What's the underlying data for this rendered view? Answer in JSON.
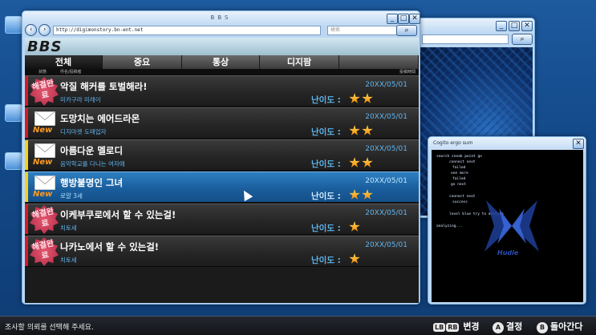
{
  "main_window": {
    "title": "BBS",
    "url": "http://digimonstory.bn-ent.net",
    "search_placeholder": "検索",
    "logo": "BBS"
  },
  "tabs": [
    {
      "label": "전체",
      "active": true
    },
    {
      "label": "중요",
      "active": false
    },
    {
      "label": "통상",
      "active": false
    },
    {
      "label": "디지팜",
      "active": false
    }
  ],
  "columns": {
    "status": "状態",
    "title": "件名/投稿者",
    "date": "投稿時間"
  },
  "difficulty_label": "난이도 :",
  "rows": [
    {
      "title": "악질 해커를 토벌해라!",
      "author": "미카구라 미레이",
      "date": "20XX/05/01",
      "stars": 2,
      "status": "seal",
      "seal_text": "해결완료",
      "accent": "#d41a2a",
      "selected": false
    },
    {
      "title": "도망치는 에어드라몬",
      "author": "디지마켓 도매업자",
      "date": "20XX/05/01",
      "stars": 2,
      "status": "new",
      "new_text": "New",
      "accent": "#d41a2a",
      "selected": false
    },
    {
      "title": "아름다운 멜로디",
      "author": "음악학교를 다니는 여자애",
      "date": "20XX/05/01",
      "stars": 2,
      "status": "new",
      "new_text": "New",
      "accent": "#f2d21c",
      "selected": false
    },
    {
      "title": "행방불명인 그녀",
      "author": "로얄 3세",
      "date": "20XX/05/01",
      "stars": 2,
      "status": "new",
      "new_text": "New",
      "accent": "#f2d21c",
      "selected": true
    },
    {
      "title": "이케부쿠로에서 할 수 있는걸!",
      "author": "치토세",
      "date": "20XX/05/01",
      "stars": 1,
      "status": "seal",
      "seal_text": "해결완료",
      "accent": "#d41a2a",
      "selected": false
    },
    {
      "title": "나카노에서 할 수 있는걸!",
      "author": "치토세",
      "date": "20XX/05/01",
      "stars": 1,
      "status": "seal",
      "seal_text": "해결완료",
      "accent": "#d41a2a",
      "selected": false
    }
  ],
  "cogito_window": {
    "title": "Cogito ergo sum",
    "lines": [
      "search sneak point go",
      "connect next",
      "failed",
      "one more",
      "failed",
      "go next",
      "connect next",
      "success",
      "level blue try to analyze",
      "analyzing..."
    ],
    "logo_text": "Hudie"
  },
  "bottom_bar": {
    "hint": "조사할 의뢰를 선택해 주세요.",
    "lb": "LB",
    "rb": "RB",
    "change": "변경",
    "a": "A",
    "confirm": "결정",
    "b": "B",
    "back": "돌아간다"
  },
  "colors": {
    "accent_blue": "#5fb3ec",
    "selected_row": "#1a5e9d",
    "star": "#f28b00",
    "new": "#ff9a1f"
  }
}
